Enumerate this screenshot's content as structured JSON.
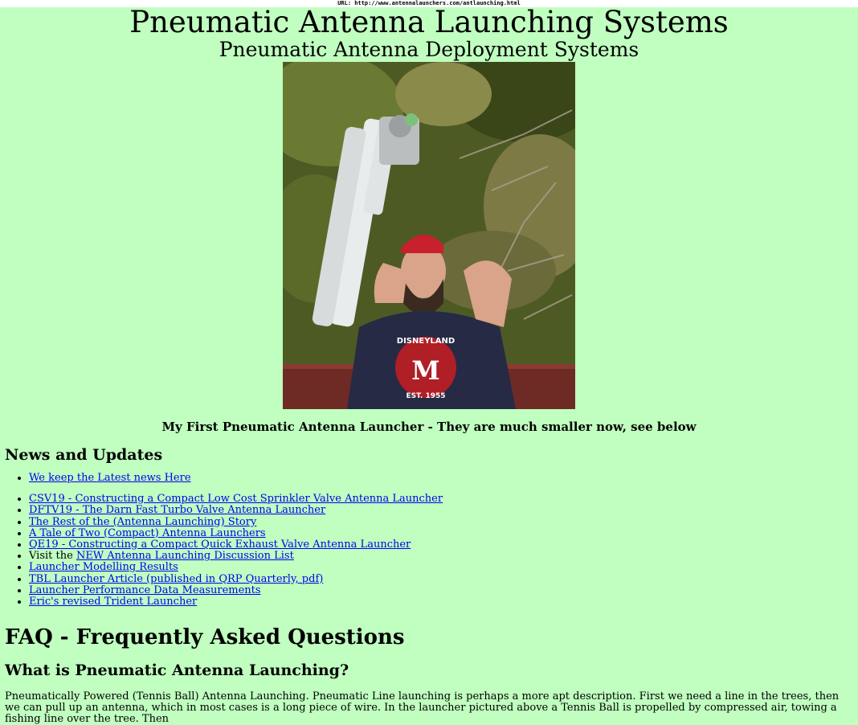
{
  "url_bar": "URL: http://www.antennalaunchers.com/antlaunching.html",
  "header": {
    "title": "Pneumatic Antenna Launching Systems",
    "subtitle": "Pneumatic Antenna Deployment Systems"
  },
  "photo": {
    "caption": "My First Pneumatic Antenna Launcher - They are much smaller now, see below",
    "shirt_text_top": "DISNEYLAND",
    "shirt_monogram": "M",
    "shirt_text_bottom": "EST. 1955"
  },
  "news": {
    "heading": "News and Updates",
    "items_first": [
      {
        "label": "We keep the Latest news Here"
      }
    ],
    "items_second": [
      {
        "prefix": "",
        "label": "CSV19 - Constructing a Compact Low Cost Sprinkler Valve Antenna Launcher"
      },
      {
        "prefix": "",
        "label": "DFTV19 - The Darn Fast Turbo Valve Antenna Launcher"
      },
      {
        "prefix": "",
        "label": "The Rest of the (Antenna Launching) Story"
      },
      {
        "prefix": "",
        "label": "A Tale of Two (Compact) Antenna Launchers"
      },
      {
        "prefix": "",
        "label": "QE19 - Constructing a Compact Quick Exhaust Valve Antenna Launcher"
      },
      {
        "prefix": "Visit the ",
        "label": "NEW Antenna Launching Discussion List"
      },
      {
        "prefix": "",
        "label": "Launcher Modelling Results"
      },
      {
        "prefix": "",
        "label": "TBL Launcher Article (published in QRP Quarterly, pdf)"
      },
      {
        "prefix": "",
        "label": "Launcher Performance Data Measurements"
      },
      {
        "prefix": "",
        "label": "Eric's revised Trident Launcher"
      }
    ]
  },
  "faq": {
    "heading": "FAQ - Frequently Asked Questions",
    "question": "What is Pneumatic Antenna Launching?",
    "answer": "Pneumatically Powered (Tennis Ball) Antenna Launching. Pneumatic Line launching is perhaps a more apt description. First we need a line in the trees, then we can pull up an antenna, which in most cases is a long piece of wire. In the launcher pictured above a Tennis Ball is propelled by compressed air, towing a fishing line over the tree. Then"
  },
  "colors": {
    "page_background": "#c0ffc0",
    "link": "#0000ee"
  }
}
